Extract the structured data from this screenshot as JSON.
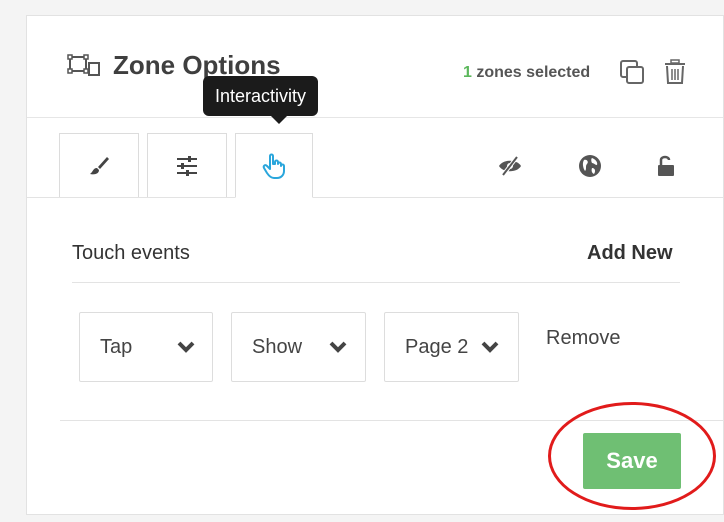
{
  "header": {
    "title": "Zone Options",
    "selected_count": "1",
    "selected_suffix": " zones selected",
    "zone_icon": "zone-selection-icon",
    "copy_icon": "copy-icon",
    "trash_icon": "trash-icon"
  },
  "tooltip": {
    "text": "Interactivity"
  },
  "tabs": [
    {
      "icon": "paintbrush-icon"
    },
    {
      "icon": "sliders-icon"
    },
    {
      "icon": "hand-pointer-icon",
      "active": true
    }
  ],
  "toggles": [
    {
      "icon": "eye-slash-icon"
    },
    {
      "icon": "globe-icon"
    },
    {
      "icon": "unlock-icon"
    }
  ],
  "touch_events": {
    "label": "Touch events",
    "add_new": "Add New",
    "rows": [
      {
        "event": "Tap",
        "action": "Show",
        "target": "Page 2",
        "remove": "Remove"
      }
    ]
  },
  "footer": {
    "save_label": "Save"
  },
  "colors": {
    "accent": "#5cb85c",
    "save_button": "#6fbf73",
    "active_tab_icon": "#2aa6dc",
    "highlight_ring": "#e11b1b",
    "tooltip_bg": "#1b1b1b"
  }
}
